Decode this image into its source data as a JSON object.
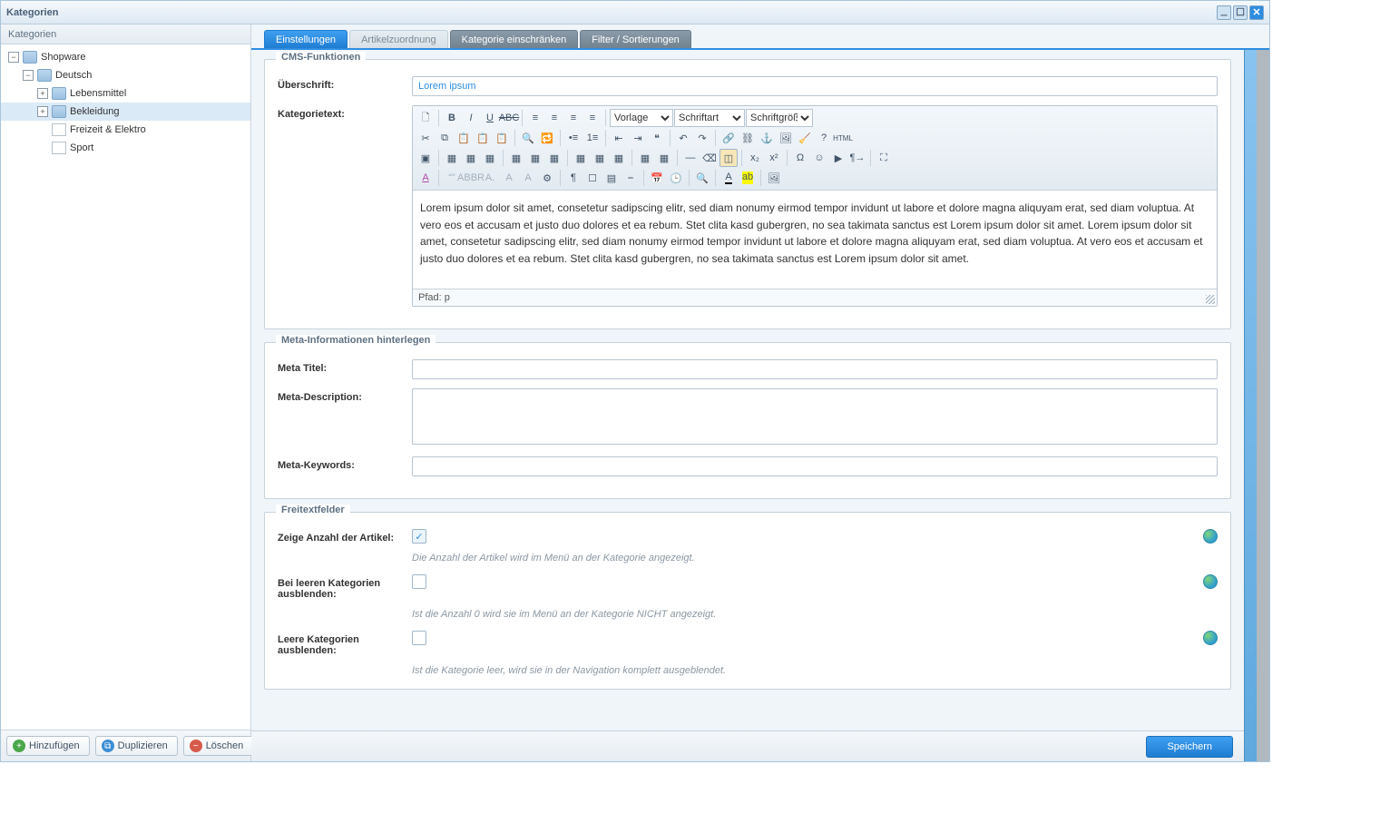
{
  "window": {
    "title": "Kategorien"
  },
  "sidebar": {
    "title": "Kategorien",
    "tree": {
      "root": "Shopware",
      "child": "Deutsch",
      "items": [
        {
          "label": "Lebensmittel",
          "expandable": true,
          "icon": "folder"
        },
        {
          "label": "Bekleidung",
          "expandable": true,
          "icon": "folder",
          "selected": true
        },
        {
          "label": "Freizeit & Elektro",
          "expandable": false,
          "icon": "page"
        },
        {
          "label": "Sport",
          "expandable": false,
          "icon": "page"
        }
      ]
    },
    "buttons": {
      "add": "Hinzufügen",
      "duplicate": "Duplizieren",
      "delete": "Löschen"
    }
  },
  "tabs": [
    {
      "label": "Einstellungen",
      "state": "active"
    },
    {
      "label": "Artikelzuordnung",
      "state": "inactive-light"
    },
    {
      "label": "Kategorie einschränken",
      "state": "inactive"
    },
    {
      "label": "Filter / Sortierungen",
      "state": "inactive"
    }
  ],
  "cms": {
    "legend": "CMS-Funktionen",
    "heading_label": "Überschrift:",
    "heading_value": "Lorem ipsum",
    "text_label": "Kategorietext:",
    "editor_templates": "Vorlage",
    "editor_fontfamily": "Schriftart",
    "editor_fontsize": "Schriftgröße",
    "editor_body": "Lorem ipsum dolor sit amet, consetetur sadipscing elitr, sed diam nonumy eirmod tempor invidunt ut labore et dolore magna aliquyam erat, sed diam voluptua. At vero eos et accusam et justo duo dolores et ea rebum. Stet clita kasd gubergren, no sea takimata sanctus est Lorem ipsum dolor sit amet. Lorem ipsum dolor sit amet, consetetur sadipscing elitr, sed diam nonumy eirmod tempor invidunt ut labore et dolore magna aliquyam erat, sed diam voluptua. At vero eos et accusam et justo duo dolores et ea rebum. Stet clita kasd gubergren, no sea takimata sanctus est Lorem ipsum dolor sit amet.",
    "editor_path": "Pfad: p"
  },
  "meta": {
    "legend": "Meta-Informationen hinterlegen",
    "title_label": "Meta Titel:",
    "desc_label": "Meta-Description:",
    "keywords_label": "Meta-Keywords:",
    "title_value": "",
    "desc_value": "",
    "keywords_value": ""
  },
  "free": {
    "legend": "Freitextfelder",
    "show_count_label": "Zeige Anzahl der Artikel:",
    "show_count_hint": "Die Anzahl der Artikel wird im Menü an der Kategorie angezeigt.",
    "hide_empty_label": "Bei leeren Kategorien ausblenden:",
    "hide_empty_hint": "Ist die Anzahl 0 wird sie im Menü an der Kategorie NICHT angezeigt.",
    "hide_empty_cat_label": "Leere Kategorien ausblenden:",
    "hide_empty_cat_hint": "Ist die Kategorie leer, wird sie in der Navigation komplett ausgeblendet.",
    "show_count_checked": true,
    "hide_empty_checked": false,
    "hide_empty_cat_checked": false
  },
  "footer": {
    "save": "Speichern"
  }
}
